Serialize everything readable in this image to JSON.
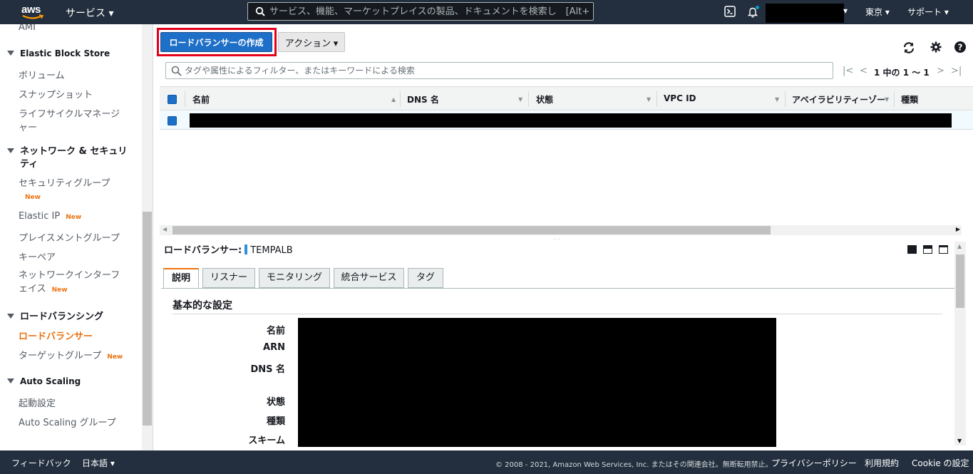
{
  "topbar": {
    "logo_text": "aws",
    "services_label": "サービス ▾",
    "search_placeholder": "サービス、機能、マーケットプレイスの製品、ドキュメントを検索し　[Alt+S]",
    "region_label": "東京 ▾",
    "support_label": "サポート ▾",
    "account_caret": "▾"
  },
  "sidebar": {
    "ami": "AMI",
    "ebs_head": "Elastic Block Store",
    "volumes": "ボリューム",
    "snapshots": "スナップショット",
    "lifecycle_1": "ライフサイクルマネージ",
    "lifecycle_2": "ャー",
    "network_head_1": "ネットワーク & セキュリ",
    "network_head_2": "ティ",
    "security_groups": "セキュリティグループ",
    "new": "New",
    "elastic_ip": "Elastic IP",
    "placement_groups": "プレイスメントグループ",
    "key_pairs": "キーペア",
    "eni_1": "ネットワークインターフ",
    "eni_2": "ェイス",
    "lb_head": "ロードバランシング",
    "load_balancers": "ロードバランサー",
    "target_groups": "ターゲットグループ",
    "as_head": "Auto Scaling",
    "launch_config": "起動設定",
    "as_groups": "Auto Scaling グループ"
  },
  "toolbar": {
    "create_label": "ロードバランサーの作成",
    "action_label": "アクション ▾"
  },
  "filter": {
    "placeholder": "タグや属性によるフィルター、またはキーワードによる検索",
    "page_info": "1 中の 1 ～ 1"
  },
  "table": {
    "col_name": "名前",
    "col_dns": "DNS 名",
    "col_state": "状態",
    "col_vpc": "VPC ID",
    "col_az": "アベイラビリティーゾー",
    "col_type": "種類"
  },
  "detail": {
    "title_prefix": "ロードバランサー:",
    "title_name": "TEMPALB",
    "tabs": [
      "説明",
      "リスナー",
      "モニタリング",
      "統合サービス",
      "タグ"
    ],
    "section": "基本的な設定",
    "labels": [
      "名前",
      "ARN",
      "DNS 名",
      "状態",
      "種類",
      "スキーム"
    ]
  },
  "footer": {
    "feedback": "フィードバック",
    "language": "日本語 ▾",
    "copyright": "© 2008 - 2021, Amazon Web Services, Inc. またはその関連会社。無断転用禁止。",
    "privacy": "プライバシーポリシー",
    "terms": "利用規約",
    "cookie": "Cookie の設定"
  },
  "colors": {
    "nav_bg": "#232f3e",
    "primary_blue": "#1e6fc7",
    "accent_orange": "#ec7211",
    "highlight_red": "#e3001b"
  },
  "icons": [
    "search-icon",
    "cloudshell-icon",
    "bell-icon",
    "refresh-icon",
    "gear-icon",
    "help-icon",
    "first-page-icon",
    "prev-page-icon",
    "next-page-icon",
    "last-page-icon"
  ]
}
